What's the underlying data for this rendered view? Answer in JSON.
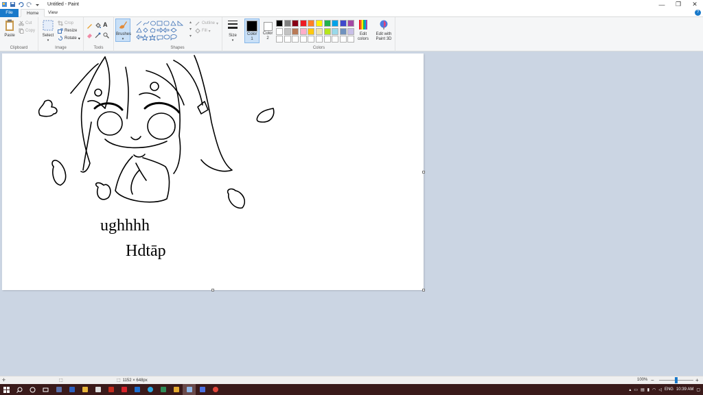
{
  "window": {
    "title": "Untitled - Paint",
    "minimize": "—",
    "maximize": "❐",
    "close": "✕"
  },
  "tabs": [
    {
      "label": "File"
    },
    {
      "label": "Home"
    },
    {
      "label": "View"
    }
  ],
  "help_glyph": "?",
  "ribbon": {
    "clipboard": {
      "label": "Clipboard",
      "paste": "Paste",
      "cut": "Cut",
      "copy": "Copy"
    },
    "image": {
      "label": "Image",
      "select": "Select",
      "crop": "Crop",
      "resize": "Resize",
      "rotate": "Rotate"
    },
    "tools": {
      "label": "Tools",
      "text_glyph": "A"
    },
    "brushes": {
      "label": "Brushes"
    },
    "shapes": {
      "label": "Shapes",
      "outline": "Outline",
      "fill": "Fill"
    },
    "size": {
      "label": "Size"
    },
    "colors": {
      "label": "Colors",
      "color1": "Color 1",
      "color2": "Color 2",
      "edit_colors": "Edit colors",
      "edit_paint3d": "Edit with Paint 3D",
      "color1_value": "#000000",
      "color2_value": "#ffffff",
      "palette_row1": [
        "#000000",
        "#7f7f7f",
        "#880015",
        "#ed1c24",
        "#ff7f27",
        "#fff200",
        "#22b14c",
        "#00a2e8",
        "#3f48cc",
        "#a349a4"
      ],
      "palette_row2": [
        "#ffffff",
        "#c3c3c3",
        "#b97a57",
        "#ffaec9",
        "#ffc90e",
        "#efe4b0",
        "#b5e61d",
        "#99d9ea",
        "#7092be",
        "#c8bfe7"
      ],
      "palette_row3": [
        "#ffffff",
        "#ffffff",
        "#ffffff",
        "#ffffff",
        "#ffffff",
        "#ffffff",
        "#ffffff",
        "#ffffff",
        "#ffffff",
        "#ffffff"
      ]
    }
  },
  "canvas": {
    "drawing_text_line1": "ughhhh",
    "drawing_text_line2": "Hdtāp"
  },
  "status": {
    "image_size": "1152 × 648px",
    "zoom": "100%",
    "zoom_out": "−",
    "zoom_in": "+"
  },
  "taskbar": {
    "lang": "ENG",
    "time": "10:39 AM"
  }
}
